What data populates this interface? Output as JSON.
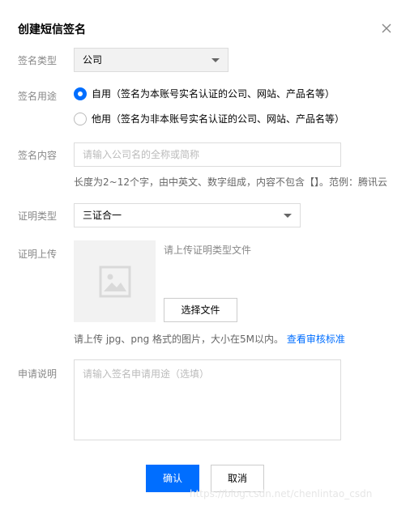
{
  "dialog": {
    "title": "创建短信签名"
  },
  "form": {
    "sign_type": {
      "label": "签名类型",
      "value": "公司"
    },
    "sign_usage": {
      "label": "签名用途",
      "options": [
        {
          "label": "自用（签名为本账号实名认证的公司、网站、产品名等）",
          "checked": true
        },
        {
          "label": "他用（签名为非本账号实名认证的公司、网站、产品名等）",
          "checked": false
        }
      ]
    },
    "sign_content": {
      "label": "签名内容",
      "placeholder": "请输入公司名的全称或简称",
      "value": "",
      "hint": "长度为2~12个字，由中英文、数字组成，内容不包含【】。范例：腾讯云"
    },
    "cert_type": {
      "label": "证明类型",
      "value": "三证合一"
    },
    "cert_upload": {
      "label": "证明上传",
      "tip": "请上传证明类型文件",
      "button_label": "选择文件",
      "hint": "请上传 jpg、png 格式的图片，大小在5M以内。",
      "link": "查看审核标准"
    },
    "description": {
      "label": "申请说明",
      "placeholder": "请输入签名申请用途（选填）",
      "value": ""
    }
  },
  "footer": {
    "confirm_label": "确认",
    "cancel_label": "取消"
  },
  "watermark": "https://blog.csdn.net/chenlintao_csdn",
  "colors": {
    "primary": "#006eff",
    "label": "#888888",
    "select_bg": "#f2f2f2"
  },
  "icons": {
    "close": "close-icon",
    "image_placeholder": "image-placeholder-icon",
    "dropdown": "chevron-down-icon"
  }
}
